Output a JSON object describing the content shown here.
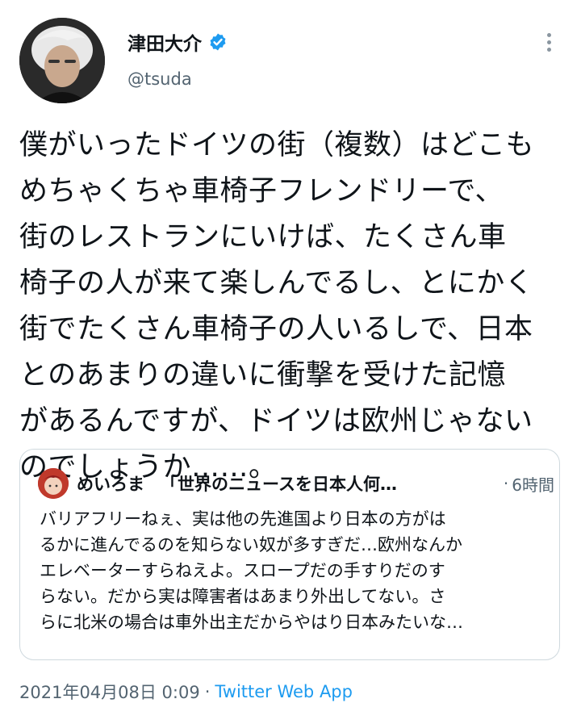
{
  "author": {
    "name": "津田大介",
    "handle": "@tsuda",
    "verified": true,
    "verified_color": "#1d9bf0"
  },
  "more_icon": "more-vertical-icon",
  "tweet": {
    "lines": [
      "僕がいったドイツの街（複数）はどこも",
      "めちゃくちゃ車椅子フレンドリーで、",
      "街のレストランにいけば、たくさん車",
      "椅子の人が来て楽しんでるし、とにかく",
      "街でたくさん車椅子の人いるしで、日本",
      "とのあまりの違いに衝撃を受けた記憶",
      "があるんですが、ドイツは欧州じゃない",
      "のでしょうか……。"
    ]
  },
  "quote": {
    "name": "めいろま",
    "title": "「世界のニュースを日本人何…",
    "dot": "·",
    "time": "6時間",
    "lines": [
      "バリアフリーねぇ、実は他の先進国より日本の方がは",
      "るかに進んでるのを知らない奴が多すぎだ…欧州なんか",
      "エレベーターすらねえよ。スロープだの手すりだのす",
      "らない。だから実は障害者はあまり外出してない。さ",
      "らに北米の場合は車外出主だからやはり日本みたいな…"
    ]
  },
  "meta": {
    "timestamp": "2021年04月08日 0:09",
    "separator": "·",
    "source": "Twitter Web App",
    "source_color": "#1d9bf0"
  }
}
